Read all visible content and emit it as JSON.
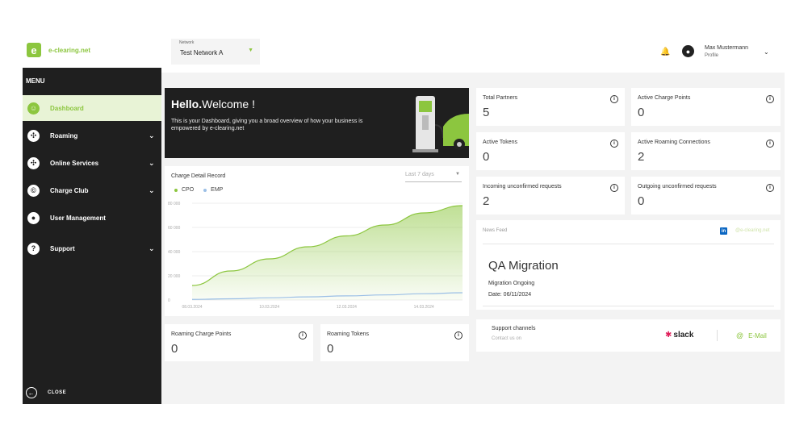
{
  "brand": {
    "name": "e-clearing.net",
    "accent": "#8cc63f",
    "dark": "#1f1f1f"
  },
  "sidebar": {
    "menu_title": "MENU",
    "items": [
      {
        "label": "Dashboard",
        "icon": "dashboard-icon",
        "active": true,
        "expandable": false
      },
      {
        "label": "Roaming",
        "icon": "roaming-icon",
        "active": false,
        "expandable": true
      },
      {
        "label": "Online Services",
        "icon": "online-services-icon",
        "active": false,
        "expandable": true
      },
      {
        "label": "Charge Club",
        "icon": "charge-club-icon",
        "active": false,
        "expandable": true
      },
      {
        "label": "User Management",
        "icon": "user-management-icon",
        "active": false,
        "expandable": false
      },
      {
        "label": "Support",
        "icon": "support-icon",
        "active": false,
        "expandable": true
      }
    ],
    "close_label": "CLOSE"
  },
  "header": {
    "network_label": "Network",
    "network_value": "Test Network A",
    "user_name": "Max Mustermann",
    "user_role": "Profile"
  },
  "welcome": {
    "title_bold": "Hello.",
    "title_rest": "Welcome !",
    "text": "This is your Dashboard, giving you a broad overview of how your business is empowered by e-clearing.net"
  },
  "kpis": {
    "total_partners": {
      "label": "Total Partners",
      "value": "5"
    },
    "active_charge_points": {
      "label": "Active Charge Points",
      "value": "0"
    },
    "active_tokens": {
      "label": "Active Tokens",
      "value": "0"
    },
    "active_roaming_connections": {
      "label": "Active Roaming Connections",
      "value": "2"
    },
    "incoming_requests": {
      "label": "Incoming unconfirmed requests",
      "value": "2"
    },
    "outgoing_requests": {
      "label": "Outgoing unconfirmed requests",
      "value": "0"
    },
    "roaming_charge_points": {
      "label": "Roaming Charge Points",
      "value": "0"
    },
    "roaming_tokens": {
      "label": "Roaming Tokens",
      "value": "0"
    }
  },
  "chart_card": {
    "title": "Charge Detail Record",
    "range": "Last 7 days"
  },
  "chart_data": {
    "type": "area",
    "title": "Charge Detail Record",
    "xlabel": "",
    "ylabel": "",
    "x": [
      "08.03.2024",
      "09.03.2024",
      "10.03.2024",
      "11.03.2024",
      "12.03.2024",
      "13.03.2024",
      "14.03.2024",
      "15.03.2024"
    ],
    "x_tick_labels": [
      "08.03.2024",
      "10.03.2024",
      "12.03.2024",
      "14.03.2024"
    ],
    "y_ticks": [
      0,
      20000,
      40000,
      60000,
      80000
    ],
    "y_tick_labels": [
      "0",
      "20 000",
      "40 000",
      "60 000",
      "80 000"
    ],
    "ylim": [
      0,
      80000
    ],
    "grid": true,
    "legend_position": "top-left",
    "series": [
      {
        "name": "CPO",
        "color": "#8cc63f",
        "values": [
          12000,
          24000,
          34000,
          44000,
          53000,
          62000,
          72000,
          78000
        ]
      },
      {
        "name": "EMP",
        "color": "#9bbfe6",
        "values": [
          500,
          1000,
          1800,
          2600,
          3400,
          4200,
          5200,
          6000
        ]
      }
    ]
  },
  "news": {
    "label": "News Feed",
    "linkedin_handle": "@e-clearing.net",
    "title": "QA Migration",
    "subtitle": "Migration Ongoing",
    "date": "Date: 06/11/2024"
  },
  "support": {
    "title": "Support channels",
    "subtitle": "Contact us on",
    "slack_label": "slack",
    "email_label": "E-Mail"
  }
}
